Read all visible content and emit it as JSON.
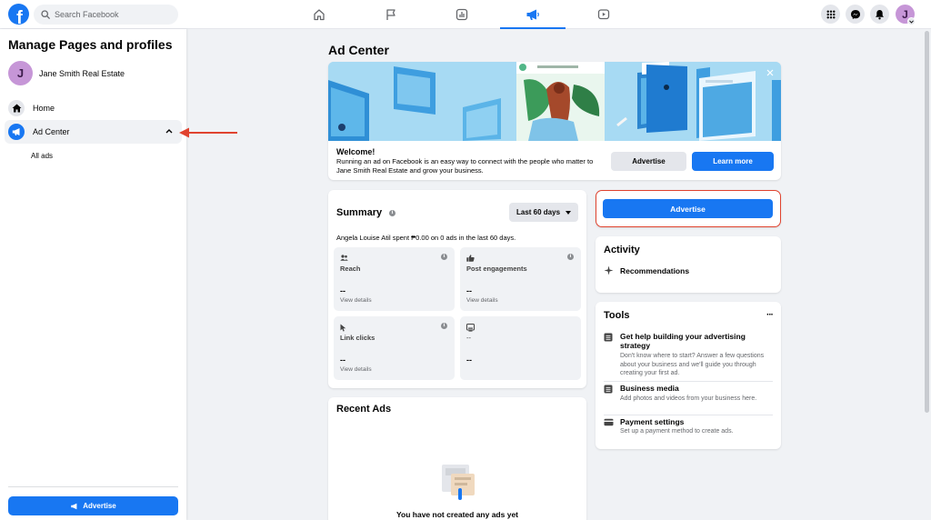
{
  "topbar": {
    "logo": "f",
    "search_placeholder": "Search Facebook",
    "nav_icons": [
      "home-icon",
      "flag-icon",
      "chart-icon",
      "megaphone-icon",
      "video-icon"
    ],
    "active_tab": "megaphone-icon",
    "right_icons": [
      "menu-grid-icon",
      "messenger-icon",
      "bell-icon"
    ],
    "avatar_initial": "J"
  },
  "sidebar": {
    "title": "Manage Pages and profiles",
    "profile_initial": "J",
    "profile_name": "Jane Smith Real Estate",
    "items": [
      {
        "label": "Home",
        "icon": "house-icon"
      },
      {
        "label": "Ad Center",
        "icon": "megaphone-icon"
      }
    ],
    "sub_item": "All ads",
    "advertise_label": "Advertise"
  },
  "main": {
    "title": "Ad Center",
    "banner": {
      "welcome_title": "Welcome!",
      "welcome_text": "Running an ad on Facebook is an easy way to connect with the people who matter to Jane Smith Real Estate and grow your business.",
      "advertise_label": "Advertise",
      "learn_more_label": "Learn more"
    },
    "summary": {
      "title": "Summary",
      "period": "Last 60 days",
      "description": "Angela Louise Atil spent ₱0.00 on 0 ads in the last 60 days.",
      "metrics": [
        {
          "label": "Reach",
          "value": "--",
          "link": "View details",
          "icon": "people-icon"
        },
        {
          "label": "Post engagements",
          "value": "--",
          "link": "View details",
          "icon": "thumbs-up-icon"
        },
        {
          "label": "Link clicks",
          "value": "--",
          "link": "View details",
          "icon": "cursor-icon"
        },
        {
          "label": "--",
          "value": "--",
          "link": "",
          "icon": "monitor-icon"
        }
      ]
    },
    "recent_ads": {
      "title": "Recent Ads",
      "empty_text": "You have not created any ads yet"
    },
    "advertise_button": "Advertise",
    "activity": {
      "title": "Activity",
      "item": "Recommendations"
    },
    "tools": {
      "title": "Tools",
      "more": "···",
      "items": [
        {
          "title": "Get help building your advertising strategy",
          "desc": "Don't know where to start? Answer a few questions about your business and we'll guide you through creating your first ad."
        },
        {
          "title": "Business media",
          "desc": "Add photos and videos from your business here."
        },
        {
          "title": "Payment settings",
          "desc": "Set up a payment method to create ads."
        }
      ]
    }
  },
  "colors": {
    "brand_blue": "#1877f2",
    "highlight_red": "#e0432f",
    "avatar_purple": "#c696d7"
  }
}
